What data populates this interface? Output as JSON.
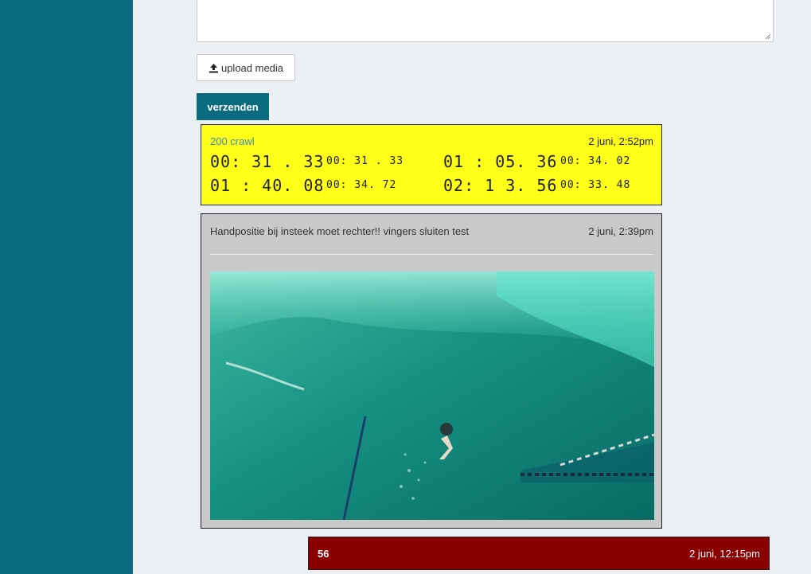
{
  "upload": {
    "label": "upload media",
    "icon": "upload-icon"
  },
  "send": {
    "label": "verzenden"
  },
  "colors": {
    "sidebar": "#0b6b7e",
    "accent": "#0b6b7e",
    "yellow_card": "#ffff1a",
    "grey_card": "#c9c9c9",
    "red_card": "#8a0000"
  },
  "timing_card": {
    "title": "200 crawl",
    "date": "2 juni, 2:52pm",
    "laps": [
      {
        "total": "00: 31 . 33",
        "split": "00: 31 . 33"
      },
      {
        "total": "01 : 05. 36",
        "split": "00: 34. 02"
      },
      {
        "total": "01 : 40. 08",
        "split": "00: 34. 72"
      },
      {
        "total": "02: 1 3. 56",
        "split": "00: 33. 48"
      }
    ]
  },
  "media_card": {
    "message": "Handpositie bij insteek moet rechter!! vingers sluiten test",
    "date": "2 juni, 2:39pm"
  },
  "score_card": {
    "value": "56",
    "date": "2 juni, 12:15pm"
  }
}
